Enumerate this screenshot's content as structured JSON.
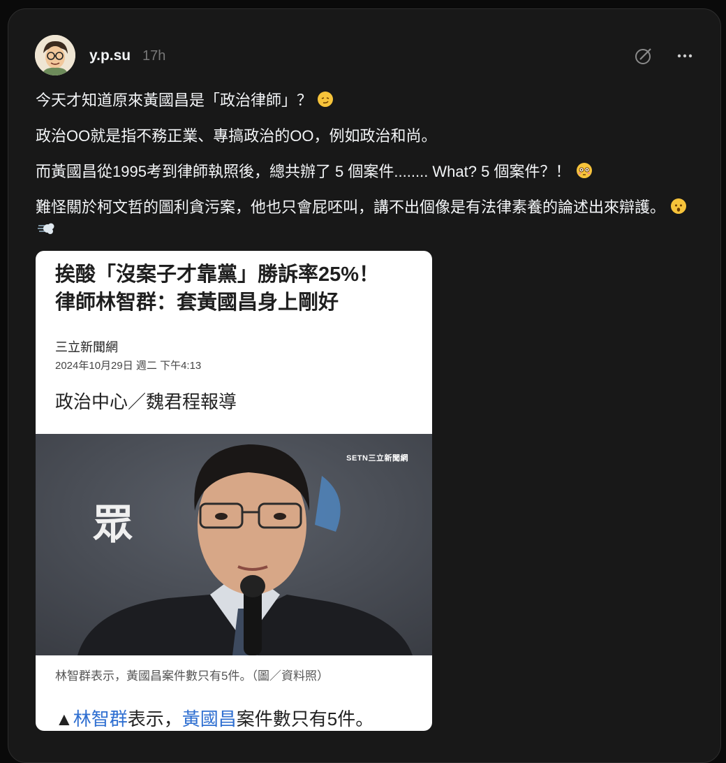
{
  "post": {
    "username": "y.p.su",
    "time": "17h",
    "paragraphs": [
      "今天才知道原來黃國昌是「政治律師」？",
      "政治OO就是指不務正業、專搞政治的OO，例如政治和尚。",
      "而黃國昌從1995考到律師執照後，總共辦了 5 個案件........ What? 5 個案件？！",
      "難怪關於柯文哲的圖利貪污案，他也只會屁呸叫，講不出個像是有法律素養的論述出來辯護。"
    ],
    "icons": {
      "edit": "compose-icon",
      "more": "more-options-icon",
      "emoji_1": "smirk-emoji",
      "emoji_2": "flushed-emoji",
      "emoji_3": "hushed-emoji",
      "emoji_4": "dash-emoji"
    }
  },
  "article": {
    "headline_line1": "挨酸「沒案子才靠黨」勝訴率25%！",
    "headline_line2": "律師林智群：套黃國昌身上剛好",
    "source": "三立新聞網",
    "date": "2024年10月29日 週二 下午4:13",
    "byline": "政治中心／魏君程報導",
    "photo_watermark": "SETN三立新聞網",
    "photo_sign": "眾",
    "caption": "林智群表示，黃國昌案件數只有5件。（圖／資料照）",
    "lead_prefix": "▲",
    "lead_link1": "林智群",
    "lead_mid": "表示，",
    "lead_link2": "黃國昌",
    "lead_suffix": "案件數只有5件。"
  }
}
